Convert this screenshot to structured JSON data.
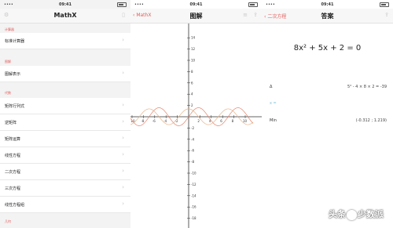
{
  "status": {
    "time": "09:41"
  },
  "panel1": {
    "title": "MathX",
    "sections": [
      {
        "header": "计算器",
        "items": [
          "标准计算器"
        ]
      },
      {
        "header": "图解",
        "items": [
          "图解表示"
        ]
      },
      {
        "header": "代数",
        "items": [
          "矩阵行列式",
          "逆矩阵",
          "矩阵运算",
          "线性方程",
          "二次方程",
          "三次方程",
          "线性方程组"
        ]
      },
      {
        "header": "几何",
        "items": []
      }
    ]
  },
  "panel2": {
    "back": "MathX",
    "title": "图解",
    "y_ticks": [
      "14",
      "12",
      "10",
      "8",
      "6",
      "4",
      "2",
      "-2",
      "-4",
      "-6",
      "-8",
      "-10",
      "-12",
      "-14",
      "-16",
      "-18",
      "-20"
    ],
    "x_ticks": [
      "-10",
      "-8",
      "-6",
      "-4",
      "-2",
      "2",
      "4",
      "6",
      "8",
      "10"
    ]
  },
  "panel3": {
    "back": "二次方程",
    "title": "答案",
    "equation": "8x² + 5x + 2 = 0",
    "delta_label": "Δ",
    "delta_value": "5² - 4 × 8 × 2 = -39",
    "x_label": "x =",
    "min_label": "Min",
    "min_value": "(-0.312 ; 1.219)"
  },
  "watermark": {
    "left": "头条",
    "right": "少数派"
  }
}
